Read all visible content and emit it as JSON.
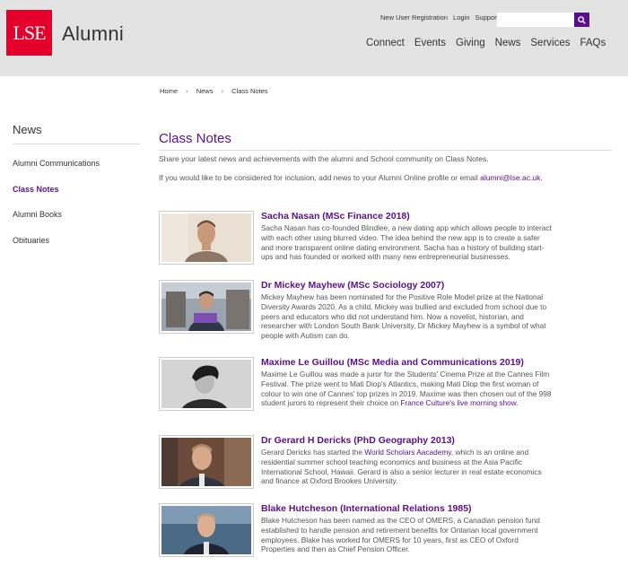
{
  "header": {
    "logo_mark": "LSE",
    "logo_text": "Alumni",
    "util_links": [
      "New User Registration",
      "Login",
      "Support"
    ],
    "search_placeholder": "",
    "nav": [
      "Connect",
      "Events",
      "Giving",
      "News",
      "Services",
      "FAQs"
    ]
  },
  "breadcrumb": [
    "Home",
    "News",
    "Class Notes"
  ],
  "sidebar": {
    "title": "News",
    "items": [
      {
        "label": "Alumni Communications",
        "active": false
      },
      {
        "label": "Class Notes",
        "active": true
      },
      {
        "label": "Alumni Books",
        "active": false
      },
      {
        "label": "Obituaries",
        "active": false
      }
    ]
  },
  "main": {
    "title": "Class Notes",
    "intro1": "Share your latest news and achievements with the alumni and School community on Class Notes.",
    "intro2_prefix": "If you would like to be considered for inclusion, add news to your Alumni Online profile or email ",
    "intro2_email": "alumni@lse.ac.uk",
    "intro2_suffix": "."
  },
  "notes": [
    {
      "title": "Sacha Nasan (MSc Finance 2018)",
      "lines": [
        "Sacha Nasan has co-founded Blindlee, a new dating app which allows people to interact",
        "with each other using blurred video. The idea behind the new app is to create a safer",
        "and more transparent online dating environment. Sacha has a history of building start-",
        "ups and has founded or worked with many new entrepreneurial businesses."
      ]
    },
    {
      "title": "Dr Mickey Mayhew (MSc Sociology 2007)",
      "lines": [
        "Mickey Mayhew has been nominated for the Positive Role Model prize at the National",
        "Diversity Awards 2020. As a child, Mickey was bullied and excluded from school due to",
        "peers and educators who did not understand him. Now a novelist, historian, and",
        "researcher with London South Bank University, Dr Mickey Mayhew is a symbol of what",
        "people with Autism can do."
      ]
    },
    {
      "title": "Maxime Le Guillou (MSc Media and Communications 2019)",
      "lines": [
        "Maxime Le Guillou was made a juror for the Students' Cinema Prize at the Cannes Film",
        "Festival. The prize went to Mati Diop's Atlantics, making Mati Diop the first woman of",
        "colour to win one of Cannes' top prizes in 2019. Maxime was then chosen out of the 998"
      ],
      "last_prefix": "student jurors to represent their choice on ",
      "last_link": "France Culture's live morning show",
      "last_suffix": "."
    },
    {
      "title": "Dr Gerard H Dericks (PhD Geography 2013)",
      "first_prefix": "Gerard Dericks has started the ",
      "first_link": "World Scholars Aacademy",
      "first_suffix": ", which is an online and",
      "lines": [
        "residential summer school teaching economics and business at the Asia Pacific",
        "International School, Hawaii. Gerard is also a senior lecturer in real estate economics",
        "and finance at Oxford Brookes University."
      ]
    },
    {
      "title": "Blake Hutcheson (International Relations 1985)",
      "lines": [
        "Blake Hutcheson has been named as the CEO of OMERS, a Canadian pension fund",
        "established to handle pension and retirement benefits for Ontarian local government",
        "employees. Blake has worked for OMERS for 10 years, first as CEO of Oxford",
        "Properties and then as Chief Pension Officer."
      ]
    }
  ],
  "colors": {
    "brand_purple": "#5b0f8b",
    "lse_red": "#e4002b",
    "header_bg": "#e3e3e3"
  },
  "icons": {
    "search": "search-icon",
    "breadcrumb_sep": "chevron-right-icon"
  }
}
